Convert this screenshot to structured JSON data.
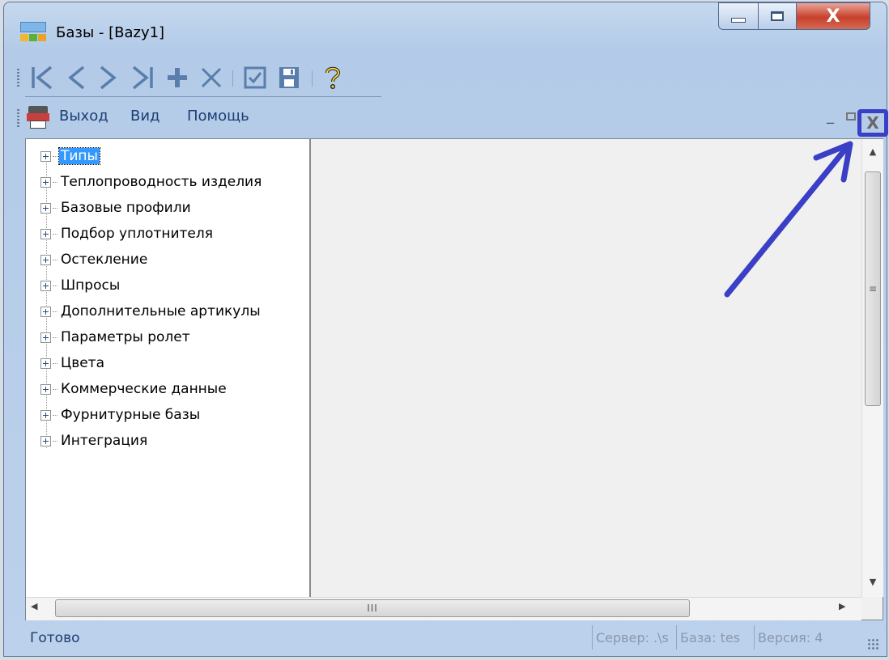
{
  "window": {
    "title": "Базы - [Bazy1]"
  },
  "window_controls": {
    "minimize": "minimize",
    "maximize": "maximize",
    "close": "X"
  },
  "toolbar": {
    "buttons": [
      {
        "name": "first-record",
        "glyph": "|<"
      },
      {
        "name": "previous",
        "glyph": "<"
      },
      {
        "name": "next",
        "glyph": ">"
      },
      {
        "name": "last-record",
        "glyph": ">|"
      },
      {
        "name": "add",
        "glyph": "+"
      },
      {
        "name": "delete",
        "glyph": "X"
      },
      {
        "name": "confirm",
        "glyph": "☑"
      },
      {
        "name": "save",
        "glyph": "💾"
      },
      {
        "name": "help",
        "glyph": "?"
      }
    ]
  },
  "menubar": {
    "items": [
      "Выход",
      "Вид",
      "Помощь"
    ],
    "mdi_close": "X"
  },
  "tree": {
    "items": [
      {
        "label": "Типы",
        "selected": true
      },
      {
        "label": "Теплопроводность изделия"
      },
      {
        "label": "Базовые профили"
      },
      {
        "label": "Подбор уплотнителя"
      },
      {
        "label": "Остекление"
      },
      {
        "label": "Шпросы"
      },
      {
        "label": "Дополнительные артикулы"
      },
      {
        "label": "Параметры ролет"
      },
      {
        "label": "Цвета"
      },
      {
        "label": "Коммерческие данные"
      },
      {
        "label": "Фурнитурные базы"
      },
      {
        "label": "Интеграция"
      }
    ]
  },
  "scrollbars": {
    "h_thumb_label": "III",
    "v_thumb_label": "≡"
  },
  "statusbar": {
    "status": "Готово",
    "server": "Сервер: .\\s",
    "base": "База: tes",
    "version": "Версия: 4"
  },
  "annotation": {
    "color": "#3a3fc6"
  }
}
